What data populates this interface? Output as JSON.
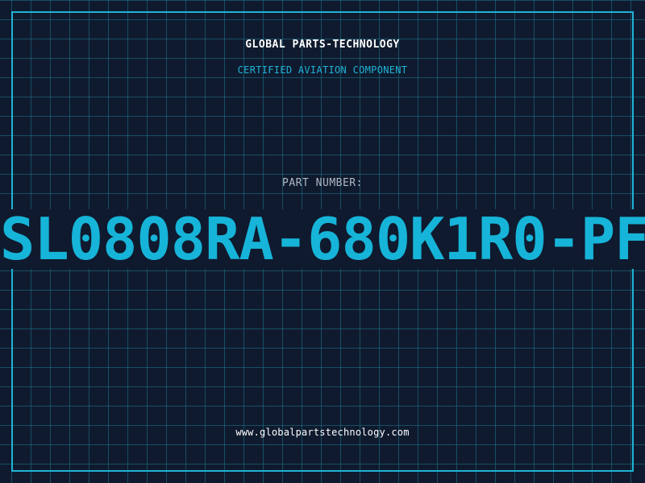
{
  "header": {
    "company": "GLOBAL PARTS-TECHNOLOGY",
    "subtitle": "CERTIFIED AVIATION COMPONENT"
  },
  "part": {
    "label": "PART NUMBER:",
    "number": "SL0808RA-680K1R0-PF"
  },
  "footer": {
    "website": "www.globalpartstechnology.com"
  },
  "colors": {
    "background": "#0f1a2e",
    "grid": "#1e788c",
    "accent": "#1fb3d6",
    "text": "#ffffff",
    "label": "#aeb8c4"
  }
}
